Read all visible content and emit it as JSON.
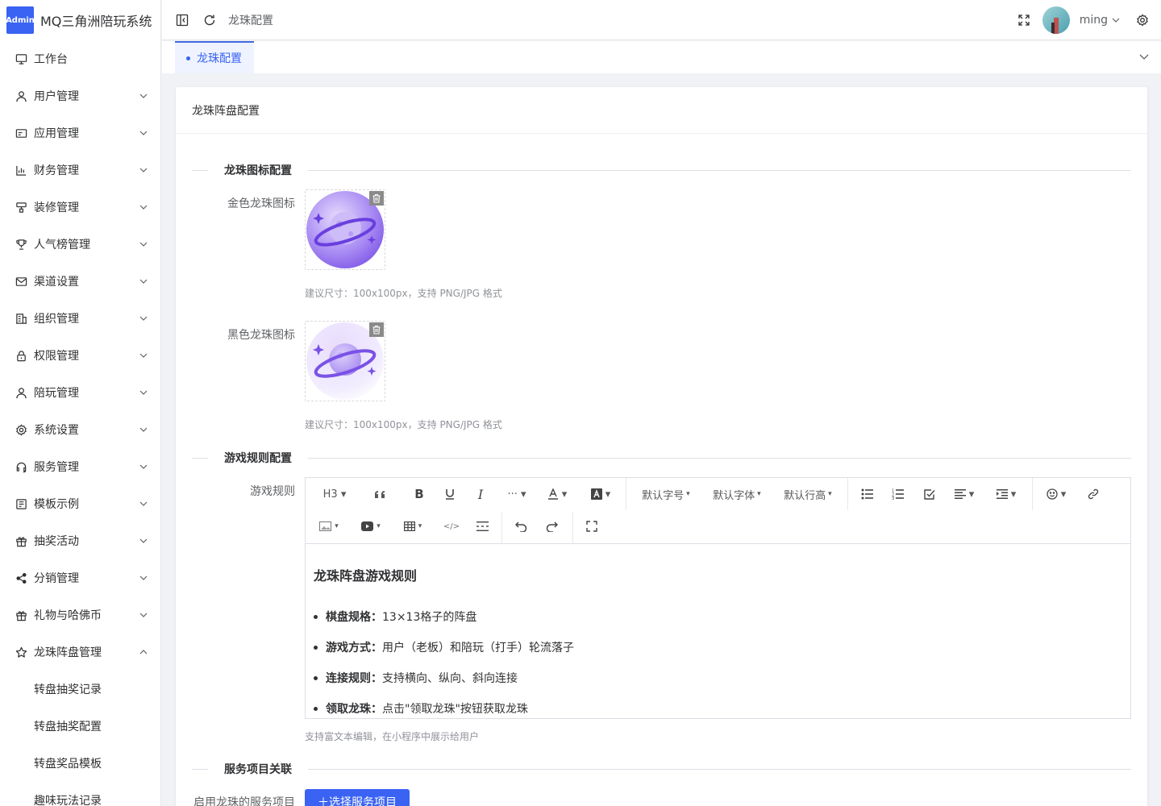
{
  "app": {
    "logo_badge": "Admin",
    "title": "MQ三角洲陪玩系统"
  },
  "sidebar": {
    "items": [
      {
        "label": "工作台",
        "icon": "monitor-icon"
      },
      {
        "label": "用户管理",
        "icon": "user-icon"
      },
      {
        "label": "应用管理",
        "icon": "app-icon"
      },
      {
        "label": "财务管理",
        "icon": "chart-icon"
      },
      {
        "label": "装修管理",
        "icon": "paint-icon"
      },
      {
        "label": "人气榜管理",
        "icon": "trophy-icon"
      },
      {
        "label": "渠道设置",
        "icon": "mail-icon"
      },
      {
        "label": "组织管理",
        "icon": "building-icon"
      },
      {
        "label": "权限管理",
        "icon": "lock-icon"
      },
      {
        "label": "陪玩管理",
        "icon": "user-icon"
      },
      {
        "label": "系统设置",
        "icon": "gear-icon"
      },
      {
        "label": "服务管理",
        "icon": "headset-icon"
      },
      {
        "label": "模板示例",
        "icon": "template-icon"
      },
      {
        "label": "抽奖活动",
        "icon": "gift-icon"
      },
      {
        "label": "分销管理",
        "icon": "share-icon"
      },
      {
        "label": "礼物与哈佛币",
        "icon": "gift-icon"
      },
      {
        "label": "龙珠阵盘管理",
        "icon": "star-icon"
      }
    ],
    "sub_items": [
      "转盘抽奖记录",
      "转盘抽奖配置",
      "转盘奖品模板",
      "趣味玩法记录"
    ]
  },
  "topbar": {
    "breadcrumb": "龙珠配置",
    "username": "ming"
  },
  "tabs": {
    "active": "龙珠配置"
  },
  "card": {
    "title": "龙珠阵盘配置",
    "section_icon": "龙珠图标配置",
    "gold_label": "金色龙珠图标",
    "black_label": "黑色龙珠图标",
    "size_hint": "建议尺寸：100x100px，支持 PNG/JPG 格式",
    "section_rules": "游戏规则配置",
    "rules_label": "游戏规则",
    "editor_hint": "支持富文本编辑，在小程序中展示给用户",
    "section_service": "服务项目关联",
    "service_label": "启用龙珠的服务项目",
    "select_button": "＋选择服务项目"
  },
  "toolbar": {
    "heading": "H3",
    "more": "···",
    "font_size": "默认字号",
    "font_family": "默认字体",
    "line_height": "默认行高"
  },
  "rules": {
    "heading": "龙珠阵盘游戏规则",
    "items": [
      {
        "key": "棋盘规格：",
        "value": "13×13格子的阵盘"
      },
      {
        "key": "游戏方式：",
        "value": "用户（老板）和陪玩（打手）轮流落子"
      },
      {
        "key": "连接规则：",
        "value": "支持横向、纵向、斜向连接"
      },
      {
        "key": "领取龙珠：",
        "value": "点击\"领取龙珠\"按钮获取龙珠"
      }
    ]
  },
  "colors": {
    "primary": "#3a63f3",
    "orb_light": "#c9b8f7",
    "orb_dark": "#7b56e8"
  }
}
